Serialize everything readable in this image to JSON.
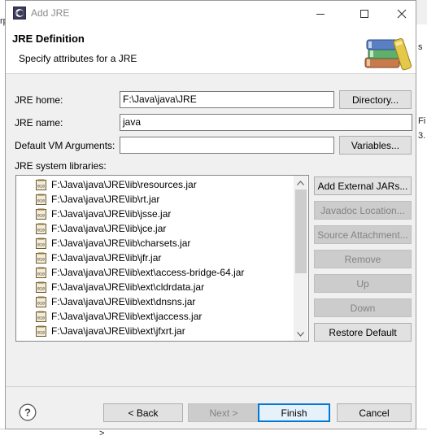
{
  "background": {
    "left_fragment": "rp",
    "right_fragment_1": "s",
    "right_fragment_2": "Fi",
    "right_fragment_3": "3.",
    "bottom_fragment": ">"
  },
  "window": {
    "title": "Add JRE",
    "controls": {
      "minimize": "—",
      "maximize": "☐",
      "close": "✕"
    }
  },
  "header": {
    "title": "JRE Definition",
    "subtitle": "Specify attributes for a JRE",
    "banner_icon": "books-icon"
  },
  "form": {
    "jre_home_label": "JRE home:",
    "jre_home_value": "F:\\Java\\java\\JRE",
    "directory_button": "Directory...",
    "jre_name_label": "JRE name:",
    "jre_name_value": "java",
    "vm_args_label": "Default VM Arguments:",
    "vm_args_value": "",
    "variables_button": "Variables..."
  },
  "libraries": {
    "label": "JRE system libraries:",
    "items": [
      "F:\\Java\\java\\JRE\\lib\\resources.jar",
      "F:\\Java\\java\\JRE\\lib\\rt.jar",
      "F:\\Java\\java\\JRE\\lib\\jsse.jar",
      "F:\\Java\\java\\JRE\\lib\\jce.jar",
      "F:\\Java\\java\\JRE\\lib\\charsets.jar",
      "F:\\Java\\java\\JRE\\lib\\jfr.jar",
      "F:\\Java\\java\\JRE\\lib\\ext\\access-bridge-64.jar",
      "F:\\Java\\java\\JRE\\lib\\ext\\cldrdata.jar",
      "F:\\Java\\java\\JRE\\lib\\ext\\dnsns.jar",
      "F:\\Java\\java\\JRE\\lib\\ext\\jaccess.jar",
      "F:\\Java\\java\\JRE\\lib\\ext\\jfxrt.jar"
    ],
    "jar_icon_text": "010",
    "buttons": {
      "add_external": "Add External JARs...",
      "javadoc": "Javadoc Location...",
      "source": "Source Attachment...",
      "remove": "Remove",
      "up": "Up",
      "down": "Down",
      "restore": "Restore Default"
    }
  },
  "footer": {
    "help_icon": "?",
    "back": "< Back",
    "next": "Next >",
    "finish": "Finish",
    "cancel": "Cancel"
  }
}
